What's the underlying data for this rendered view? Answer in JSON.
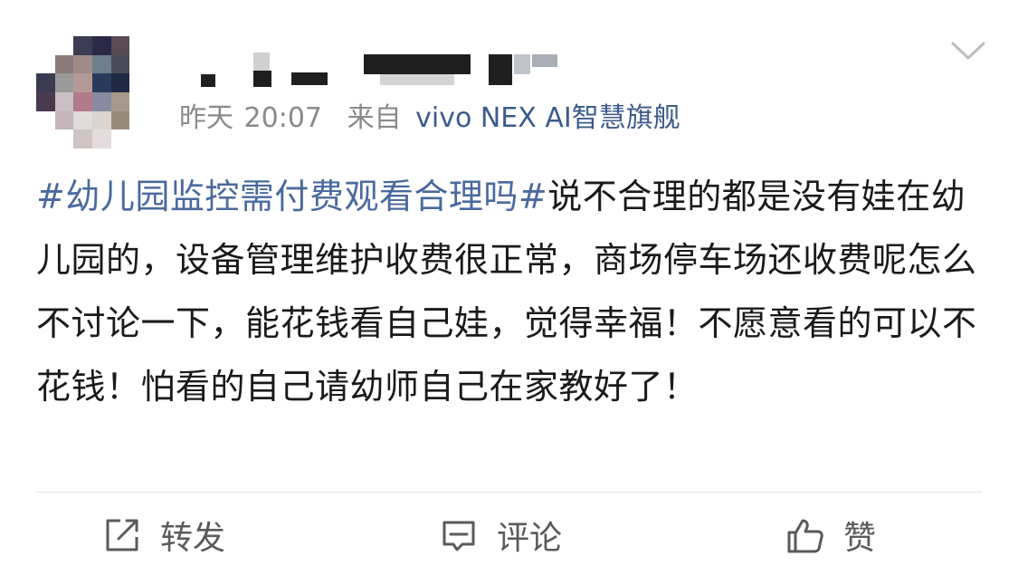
{
  "post": {
    "time_label": "昨天",
    "time": "20:07",
    "source_label": "来自",
    "device": "vivo NEX AI智慧旗舰",
    "hashtag": "#幼儿园监控需付费观看合理吗#",
    "body": "说不合理的都是没有娃在幼儿园的，设备管理维护收费很正常，商场停车场还收费呢怎么不讨论一下，能花钱看自己娃，觉得幸福！不愿意看的可以不花钱！怕看的自己请幼师自己在家教好了！"
  },
  "actions": {
    "forward_label": "转发",
    "comment_label": "评论",
    "like_label": "赞"
  },
  "colors": {
    "hashtag": "#4a6a9e",
    "device": "#3d5b8c",
    "meta": "#8a8a8a",
    "text": "#1a1a1a",
    "action": "#5a5a5a"
  },
  "icons": {
    "menu": "chevron-down-icon",
    "forward": "share-external-icon",
    "comment": "comment-bubble-icon",
    "like": "thumbs-up-icon"
  }
}
